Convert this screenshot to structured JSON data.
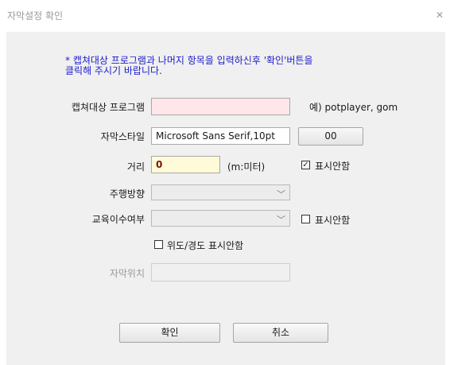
{
  "window": {
    "title": "자막설정 확인",
    "close_glyph": "✕"
  },
  "notice": {
    "line1": "* 캡쳐대상 프로그램과 나머지 항목을 입력하신후 '확인'버튼을",
    "line2": "클릭해 주시기 바랍니다."
  },
  "capture": {
    "label": "캡쳐대상 프로그램",
    "value": "",
    "hint": "예) potplayer, gom"
  },
  "font": {
    "label": "자막스타일",
    "value": "Microsoft Sans Serif,10pt",
    "button_label": "00"
  },
  "distance": {
    "label": "거리",
    "value": "0",
    "unit": "(m:미터)",
    "hide_label": "표시안함",
    "hide_checked": true
  },
  "direction": {
    "label": "주행방향",
    "selected": ""
  },
  "completion": {
    "label": "교육이수여부",
    "selected": "",
    "hide_label": "표시안함",
    "hide_checked": false
  },
  "latlng": {
    "hide_label": "위도/경도 표시안함",
    "hide_checked": false
  },
  "position": {
    "label": "자막위치",
    "value": ""
  },
  "buttons": {
    "ok_label": "확인",
    "cancel_label": "취소"
  },
  "icons": {
    "dropdown": "chevron-down-icon",
    "checkmark": "✓",
    "chevron": "﹀"
  }
}
